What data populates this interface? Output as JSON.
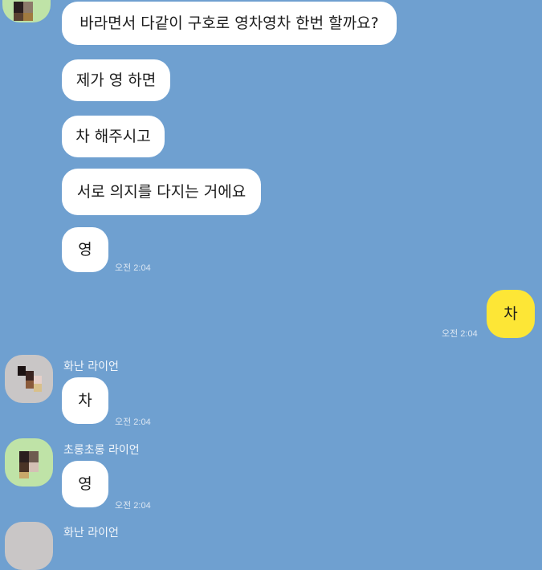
{
  "colors": {
    "background": "#6fa0d0",
    "bubble_other": "#ffffff",
    "bubble_me": "#fde636"
  },
  "messages": [
    {
      "text": "바라면서 다같이 구호로 영차영차 한번 할까요?"
    },
    {
      "text": "제가 영 하면"
    },
    {
      "text": "차 해주시고"
    },
    {
      "text": "서로 의지를 다지는 거에요"
    },
    {
      "text": "영",
      "time": "오전 2:04"
    }
  ],
  "my_message": {
    "text": "차",
    "time": "오전 2:04"
  },
  "chat_group_1": {
    "sender": "화난 라이언",
    "text": "차",
    "time": "오전 2:04"
  },
  "chat_group_2": {
    "sender": "초롱초롱 라이언",
    "text": "영",
    "time": "오전 2:04"
  },
  "chat_group_3": {
    "sender": "화난 라이언"
  }
}
